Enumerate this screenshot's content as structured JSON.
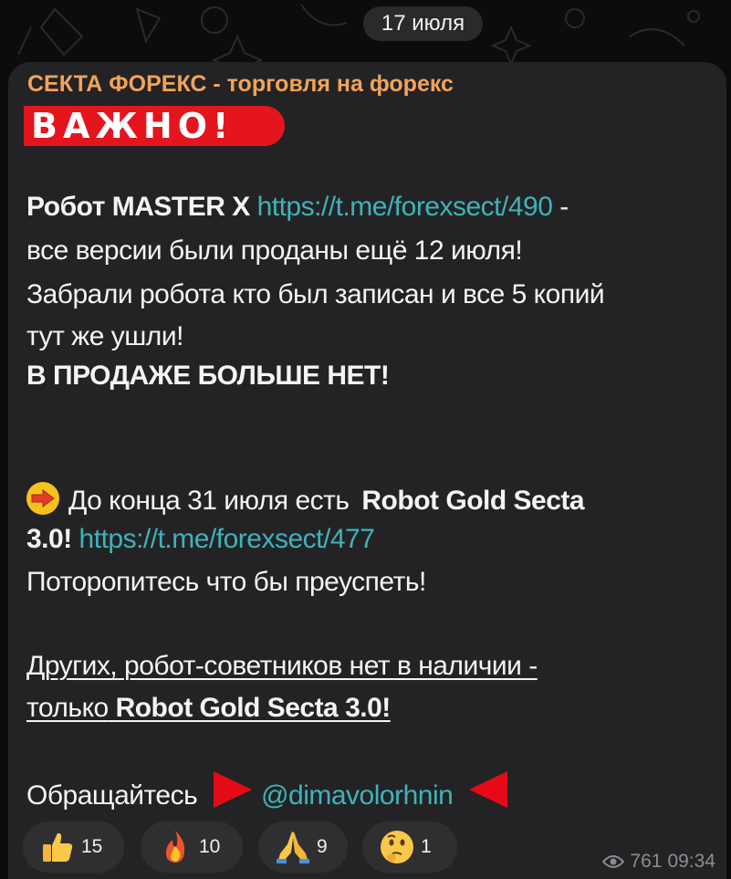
{
  "date_pill": "17 июля",
  "message": {
    "channel_name": "СЕКТА ФОРЕКС - торговля на форекс",
    "banner": "ВАЖНО!",
    "p1": {
      "robot_label": "Робот MASTER X",
      "link1": "https://t.me/forexsect/490",
      "dash": " -",
      "line2": "все версии были проданы ещё 12 июля!",
      "line3": "Забрали робота кто был записан и все 5 копий",
      "line4": "тут же ушли!",
      "line5": "В ПРОДАЖЕ БОЛЬШЕ НЕТ!"
    },
    "p2": {
      "lead": "До конца 31 июля есть",
      "product": "Robot Gold Secta",
      "product_end": "3.0!",
      "link2": "https://t.me/forexsect/477",
      "line3": "Поторопитесь что бы преуспеть!"
    },
    "p3": {
      "line1": "Других, робот-советников нет в наличии -",
      "line2_a": "только",
      "line2_b": "Robot Gold Secta 3.0!"
    },
    "contact": {
      "lead": "Обращайтесь",
      "handle": "@dimavolorhnin"
    }
  },
  "reactions": [
    {
      "icon": "thumbs-up-icon",
      "count": "15"
    },
    {
      "icon": "fire-icon",
      "count": "10"
    },
    {
      "icon": "folded-hands-icon",
      "count": "9"
    },
    {
      "icon": "thinking-face-icon",
      "count": "1"
    }
  ],
  "meta": {
    "views": "761",
    "time": "09:34"
  },
  "colors": {
    "accent_name": "#f2a35a",
    "link": "#3fb3b9",
    "banner": "#e5151d",
    "bubble": "#232325"
  }
}
